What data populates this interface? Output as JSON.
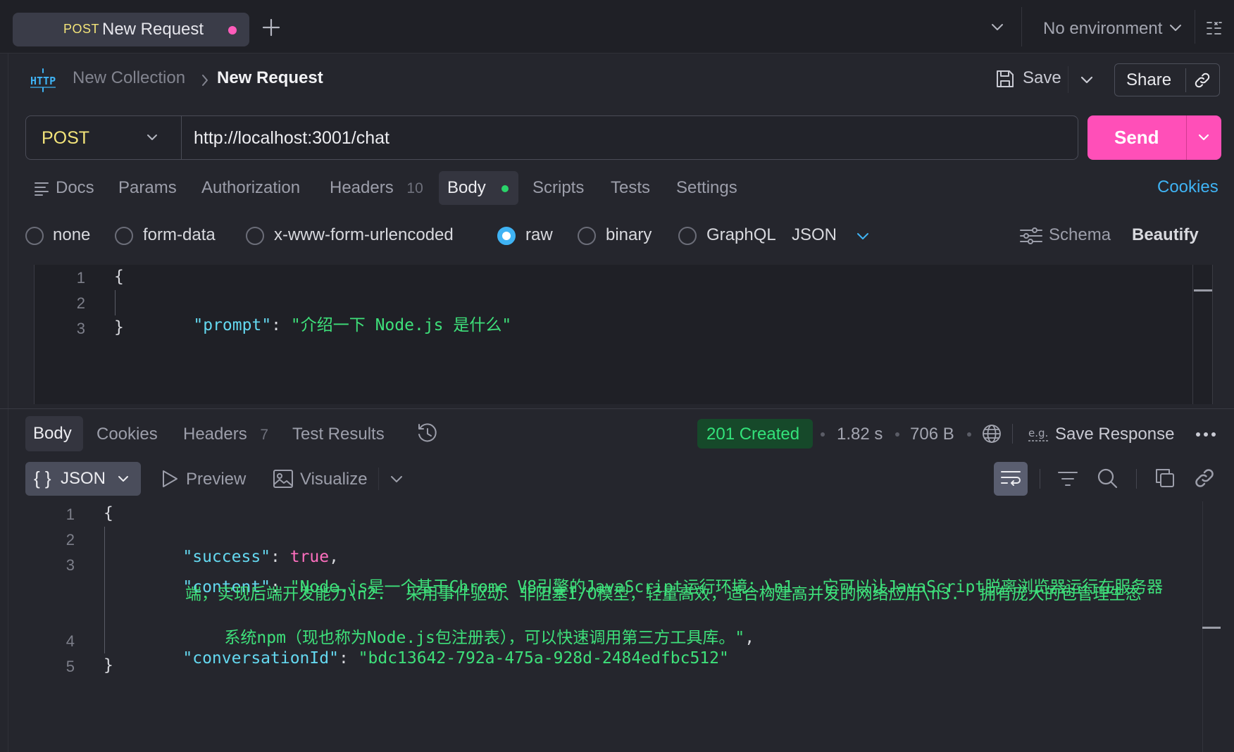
{
  "tabbar": {
    "tab": {
      "method": "POST",
      "label": "New Request"
    },
    "environment": "No environment"
  },
  "header": {
    "badge_icon": "http-icon",
    "collection": "New Collection",
    "request": "New Request",
    "save_label": "Save",
    "share_label": "Share"
  },
  "urlbar": {
    "method": "POST",
    "url": "http://localhost:3001/chat",
    "send_label": "Send"
  },
  "request_tabs": {
    "docs": "Docs",
    "params": "Params",
    "authorization": "Authorization",
    "headers": "Headers",
    "headers_count": "10",
    "body": "Body",
    "scripts": "Scripts",
    "tests": "Tests",
    "settings": "Settings",
    "cookies": "Cookies"
  },
  "body_types": {
    "none": "none",
    "form_data": "form-data",
    "urlencoded": "x-www-form-urlencoded",
    "raw": "raw",
    "binary": "binary",
    "graphql": "GraphQL",
    "language": "JSON",
    "schema": "Schema",
    "beautify": "Beautify",
    "selected": "raw"
  },
  "request_body": {
    "line_numbers": [
      "1",
      "2",
      "3"
    ],
    "open_brace": "{",
    "key": "\"prompt\"",
    "colon": ": ",
    "value": "\"介绍一下 Node.js 是什么\"",
    "close_brace": "}"
  },
  "response_tabs": {
    "body": "Body",
    "cookies": "Cookies",
    "headers": "Headers",
    "headers_count": "7",
    "test_results": "Test Results"
  },
  "response_meta": {
    "status": "201 Created",
    "time": "1.82 s",
    "size": "706 B",
    "save_response": "Save Response"
  },
  "response_toolbar": {
    "format": "JSON",
    "preview": "Preview",
    "visualize": "Visualize"
  },
  "response_body": {
    "line_numbers": [
      "1",
      "2",
      "3",
      "4",
      "5"
    ],
    "open_brace": "{",
    "success_key": "\"success\"",
    "success_value": "true",
    "content_key": "\"content\"",
    "content_line1": "\"Node.js是一个基于Chrome V8引擎的JavaScript运行环境：\\n1.  它可以让JavaScript脱离浏览器运行在服务器",
    "content_line2": "端，实现后端开发能力\\n2.  采用事件驱动、非阻塞I/O模型，轻量高效，适合构建高并发的网络应用\\n3.  拥有庞大的包管理生态",
    "content_line3": "系统npm（现也称为Node.js包注册表），可以快速调用第三方工具库。\"",
    "conversation_key": "\"conversationId\"",
    "conversation_value": "\"bdc13642-792a-475a-928d-2484edfbc512\"",
    "close_brace": "}"
  },
  "colors": {
    "accent_pink": "#ff4fb8",
    "method_yellow": "#f3e47a",
    "link_blue": "#3fb3f4",
    "status_green": "#33e27a"
  }
}
